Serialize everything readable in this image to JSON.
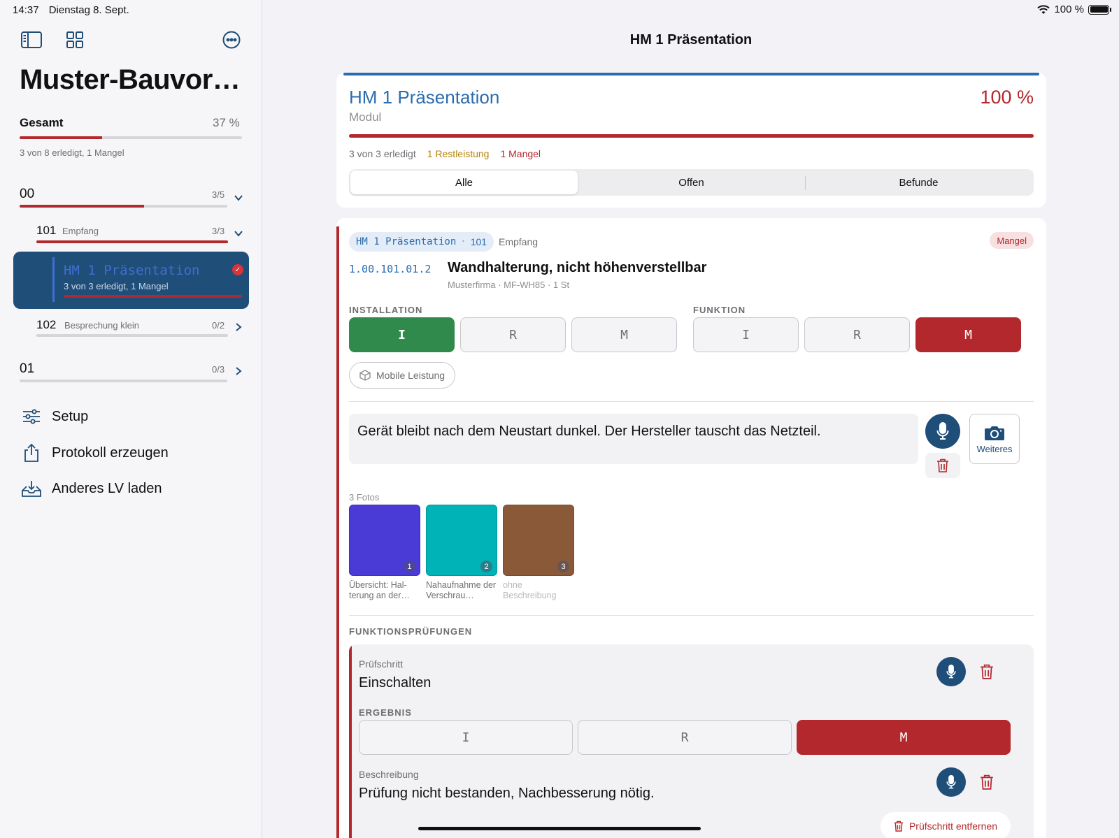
{
  "status": {
    "time": "14:37",
    "date": "Dienstag 8. Sept.",
    "battery": "100 %"
  },
  "sidebar": {
    "title": "Muster-Bauvor…",
    "overall": {
      "label": "Gesamt",
      "percent": "37 %",
      "progress": 0.37,
      "summary": "3 von 8 erledigt, 1 Mangel"
    },
    "groups": [
      {
        "code": "00",
        "count": "3/5",
        "progress": 0.6
      },
      {
        "code": "01",
        "count": "0/3",
        "progress": 0.0
      }
    ],
    "subgroups": [
      {
        "code": "101",
        "name": "Empfang",
        "count": "3/3",
        "progress": 1.0
      },
      {
        "code": "102",
        "name": "Besprechung klein",
        "count": "0/2",
        "progress": 0.0
      }
    ],
    "active_item": {
      "name": "HM 1 Präsentation",
      "summary": "3 von 3 erledigt, 1 Mangel"
    },
    "menu": [
      {
        "label": "Setup",
        "icon": "sliders-icon"
      },
      {
        "label": "Protokoll erzeugen",
        "icon": "share-icon"
      },
      {
        "label": "Anderes LV laden",
        "icon": "tray-download-icon"
      }
    ]
  },
  "main": {
    "nav_title": "HM 1 Präsentation",
    "summary": {
      "title": "HM 1 Präsentation",
      "kind": "Modul",
      "percent": "100 %",
      "progress": 1.0,
      "done": "3 von 3 erledigt",
      "rest": "1 Restleistung",
      "defects": "1 Mangel",
      "segments": [
        "Alle",
        "Offen",
        "Befunde"
      ],
      "selected_segment": "Alle"
    },
    "item": {
      "pill_name": "HM 1 Präsentation",
      "pill_sep": "·",
      "pill_code": "101",
      "pill_room": "Empfang",
      "badge": "Mangel",
      "code": "1.00.101.01.2",
      "title": "Wandhalterung, nicht höhenverstellbar",
      "subtitle": "Musterfirma · MF-WH85 · 1 St",
      "installation_label": "INSTALLATION",
      "funktion_label": "FUNKTION",
      "installation_buttons": [
        "I",
        "R",
        "M"
      ],
      "installation_selected": "I",
      "funktion_buttons": [
        "I",
        "R",
        "M"
      ],
      "funktion_selected": "M",
      "chip": "Mobile Leistung",
      "note": "Gerät bleibt nach dem Neustart dunkel. Der Hersteller tauscht das Netzteil.",
      "more_label": "Weiteres",
      "photos_label": "3 Fotos",
      "photos": [
        {
          "num": "1",
          "color": "#4a3ad6",
          "caption": "Übersicht: Hal- terung an der…"
        },
        {
          "num": "2",
          "color": "#00b3b7",
          "caption": "Nahaufnahme der Verschrau…"
        },
        {
          "num": "3",
          "color": "#8a5a38",
          "caption": "ohne Beschreibung"
        }
      ],
      "checks_label": "FUNKTIONSPRÜFUNGEN",
      "step": {
        "step_label": "Prüfschritt",
        "step_value": "Einschalten",
        "result_label": "ERGEBNIS",
        "result_buttons": [
          "I",
          "R",
          "M"
        ],
        "result_selected": "M",
        "desc_label": "Beschreibung",
        "desc_value": "Prüfung nicht bestanden, Nachbesserung nötig.",
        "remove_label": "Prüfschritt entfernen"
      }
    }
  },
  "colors": {
    "accent": "#1f4e79",
    "link": "#2b6cb0",
    "danger": "#b3282d",
    "success": "#2f8a4c",
    "warning": "#b7820b"
  }
}
